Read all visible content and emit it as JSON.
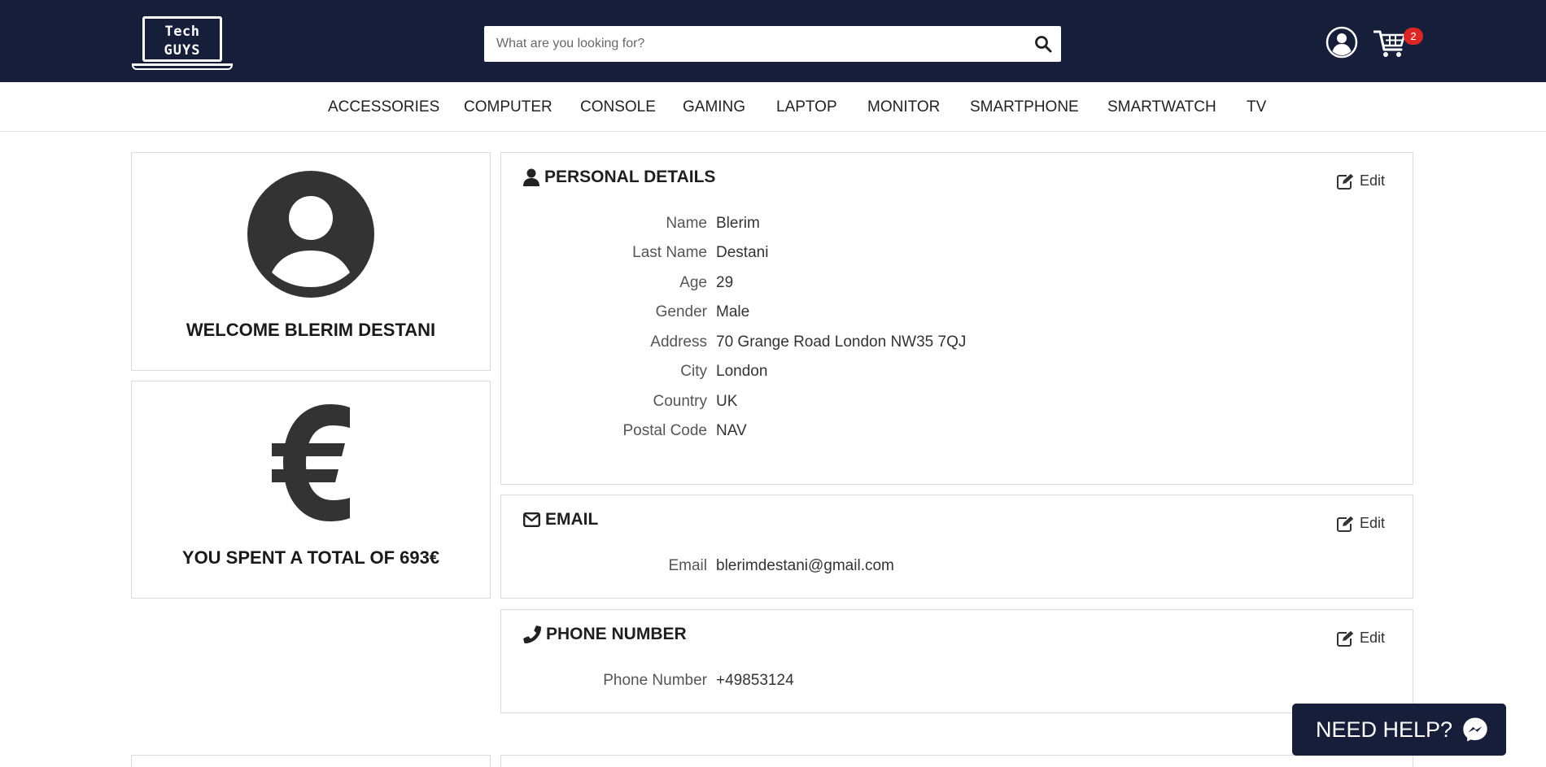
{
  "brand": {
    "logo_line1": "Tech",
    "logo_line2": "GUYS"
  },
  "search": {
    "placeholder": "What are you looking for?",
    "value": ""
  },
  "header_icons": {
    "account_icon": "user-circle-icon",
    "cart_icon": "shopping-cart-icon",
    "cart_count": "2"
  },
  "categories": [
    "ACCESSORIES",
    "COMPUTER",
    "CONSOLE",
    "GAMING",
    "LAPTOP",
    "MONITOR",
    "SMARTPHONE",
    "SMARTWATCH",
    "TV"
  ],
  "welcome": {
    "text": "WELCOME BLERIM DESTANI",
    "icon": "user-circle-icon"
  },
  "spending": {
    "text": "YOU SPENT A TOTAL OF 693€",
    "icon": "euro-icon"
  },
  "personal_details": {
    "title": "PERSONAL DETAILS",
    "icon": "user-icon",
    "edit_label": "Edit",
    "fields": [
      {
        "label": "Name",
        "value": "Blerim"
      },
      {
        "label": "Last Name",
        "value": "Destani"
      },
      {
        "label": "Age",
        "value": "29"
      },
      {
        "label": "Gender",
        "value": "Male"
      },
      {
        "label": "Address",
        "value": "70 Grange Road London NW35 7QJ"
      },
      {
        "label": "City",
        "value": "London"
      },
      {
        "label": "Country",
        "value": "UK"
      },
      {
        "label": "Postal Code",
        "value": "NAV"
      }
    ]
  },
  "email": {
    "title": "EMAIL",
    "icon": "envelope-icon",
    "edit_label": "Edit",
    "fields": [
      {
        "label": "Email",
        "value": "blerimdestani@gmail.com"
      }
    ]
  },
  "phone": {
    "title": "PHONE NUMBER",
    "icon": "phone-icon",
    "edit_label": "Edit",
    "fields": [
      {
        "label": "Phone Number",
        "value": "+49853124"
      }
    ]
  },
  "help_button": {
    "label": "NEED HELP?",
    "icon": "messenger-icon"
  },
  "colors": {
    "header_bg": "#161e3a",
    "badge": "#dc2626",
    "icon_dark": "#333333"
  }
}
